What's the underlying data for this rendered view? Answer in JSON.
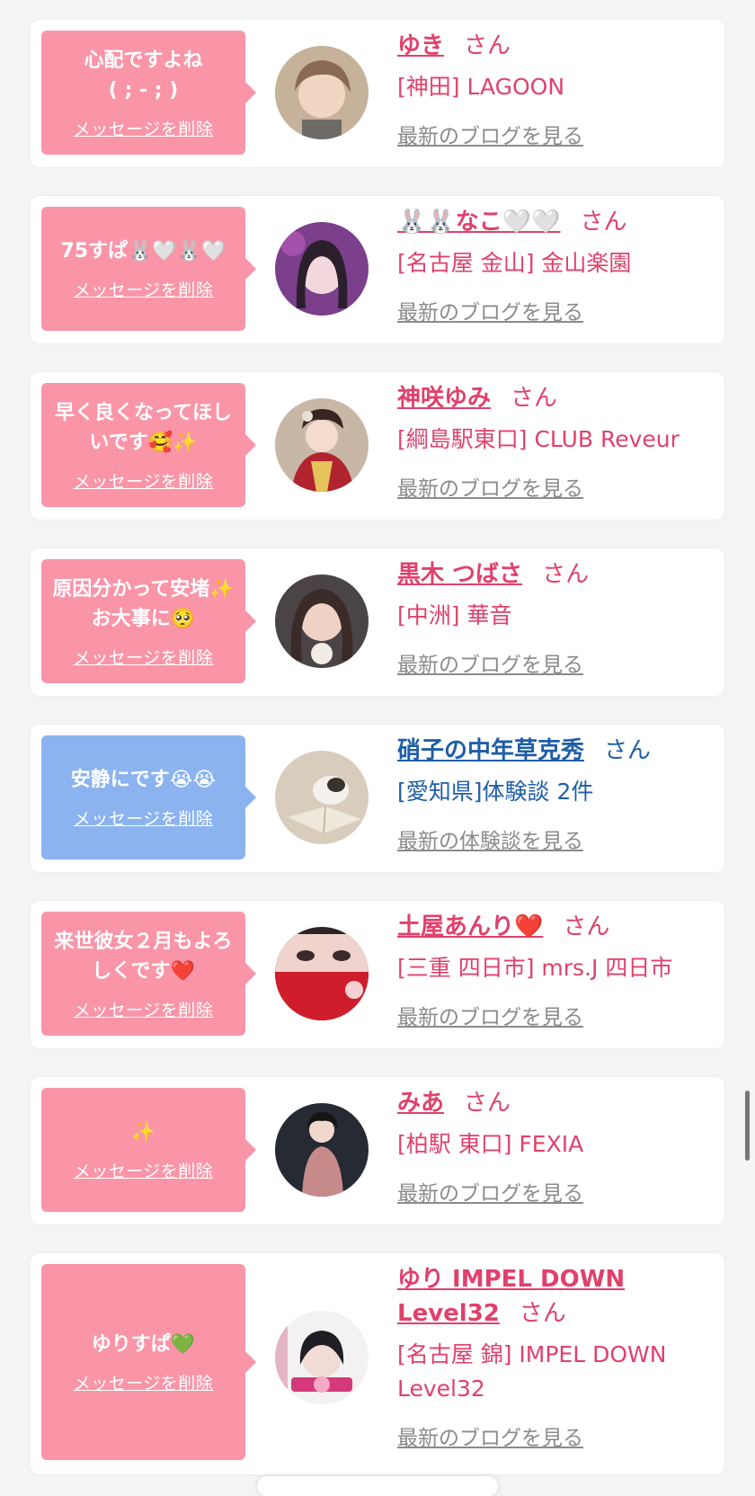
{
  "items": [
    {
      "variant": "pink",
      "message": "心配ですよね\n( ; - ; )",
      "delete_label": "メッセージを削除",
      "name": "ゆき",
      "honorific": "さん",
      "place": "[神田] LAGOON",
      "link": "最新のブログを見る",
      "avatar": "avatar-photo-1"
    },
    {
      "variant": "pink",
      "message": "75すぱ🐰🤍🐰🤍",
      "delete_label": "メッセージを削除",
      "name": "🐰🐰なこ🤍🤍",
      "honorific": "さん",
      "place": "[名古屋 金山] 金山楽園",
      "link": "最新のブログを見る",
      "avatar": "avatar-photo-2"
    },
    {
      "variant": "pink",
      "message": "早く良くなってほしいです🥰✨",
      "delete_label": "メッセージを削除",
      "name": "神咲ゆみ",
      "honorific": "さん",
      "place": "[綱島駅東口] CLUB Reveur",
      "link": "最新のブログを見る",
      "avatar": "avatar-photo-3"
    },
    {
      "variant": "pink",
      "message": "原因分かって安堵✨お大事に🥺",
      "delete_label": "メッセージを削除",
      "name": "黒木 つばさ",
      "honorific": "さん",
      "place": "[中洲] 華音",
      "link": "最新のブログを見る",
      "avatar": "avatar-photo-4"
    },
    {
      "variant": "blue",
      "message": "安静にです😭😭",
      "delete_label": "メッセージを削除",
      "name": "硝子の中年草克秀",
      "honorific": "さん",
      "place": "[愛知県]体験談 2件",
      "link": "最新の体験談を見る",
      "avatar": "avatar-photo-cat"
    },
    {
      "variant": "pink",
      "message": "来世彼女２月もよろしくです❤️",
      "delete_label": "メッセージを削除",
      "name": "土屋あんり❤️",
      "honorific": "さん",
      "place": "[三重 四日市] mrs.J 四日市",
      "link": "最新のブログを見る",
      "avatar": "avatar-photo-6"
    },
    {
      "variant": "pink",
      "message": "✨",
      "delete_label": "メッセージを削除",
      "name": "みあ",
      "honorific": "さん",
      "place": "[柏駅 東口] FEXIA",
      "link": "最新のブログを見る",
      "avatar": "avatar-photo-7"
    },
    {
      "variant": "pink",
      "message": "ゆりすぱ💚",
      "delete_label": "メッセージを削除",
      "name": "ゆり IMPEL DOWN Level32",
      "honorific": "さん",
      "place": "[名古屋 錦] IMPEL DOWN Level32",
      "link": "最新のブログを見る",
      "avatar": "avatar-photo-8"
    }
  ]
}
